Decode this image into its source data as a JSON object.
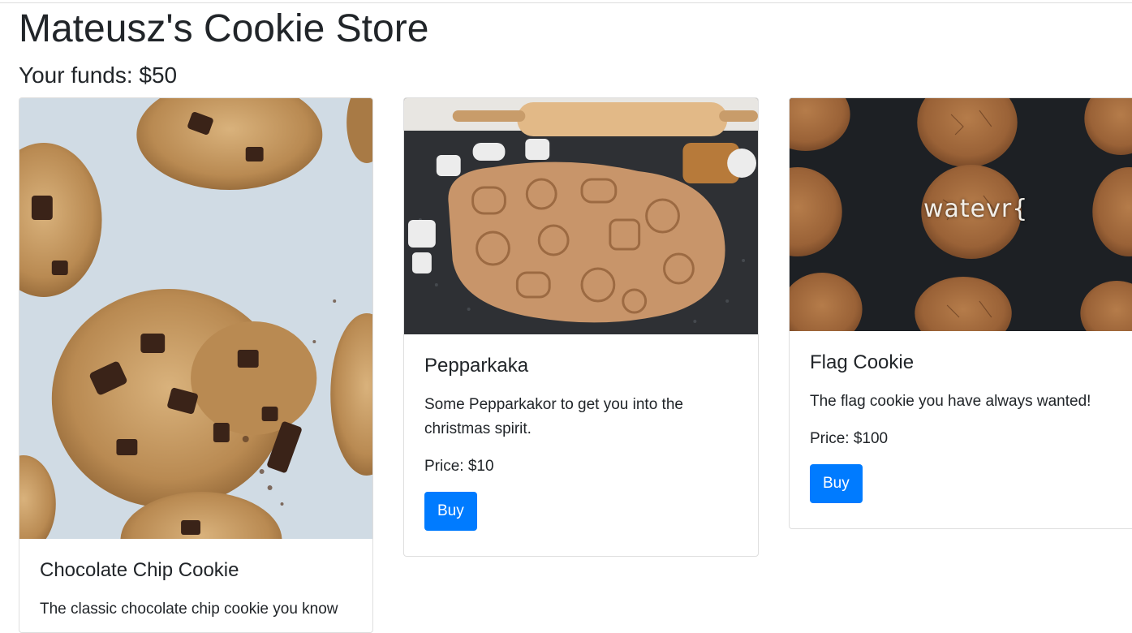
{
  "store": {
    "title": "Mateusz's Cookie Store",
    "funds": "Your funds: $50"
  },
  "products": [
    {
      "name": "Chocolate Chip Cookie",
      "description": "The classic chocolate chip cookie you know",
      "image": "chocolate-chip-cookies-photo"
    },
    {
      "name": "Pepparkaka",
      "description": "Some Pepparkakor to get you into the christmas spirit.",
      "price": "Price: $10",
      "buy_label": "Buy",
      "image": "gingerbread-dough-photo"
    },
    {
      "name": "Flag Cookie",
      "description": "The flag cookie you have always wanted!",
      "price": "Price: $100",
      "buy_label": "Buy",
      "image": "flag-cookies-photo",
      "image_caption": "watevr{"
    }
  ],
  "colors": {
    "primary": "#007bff",
    "text": "#212529"
  }
}
